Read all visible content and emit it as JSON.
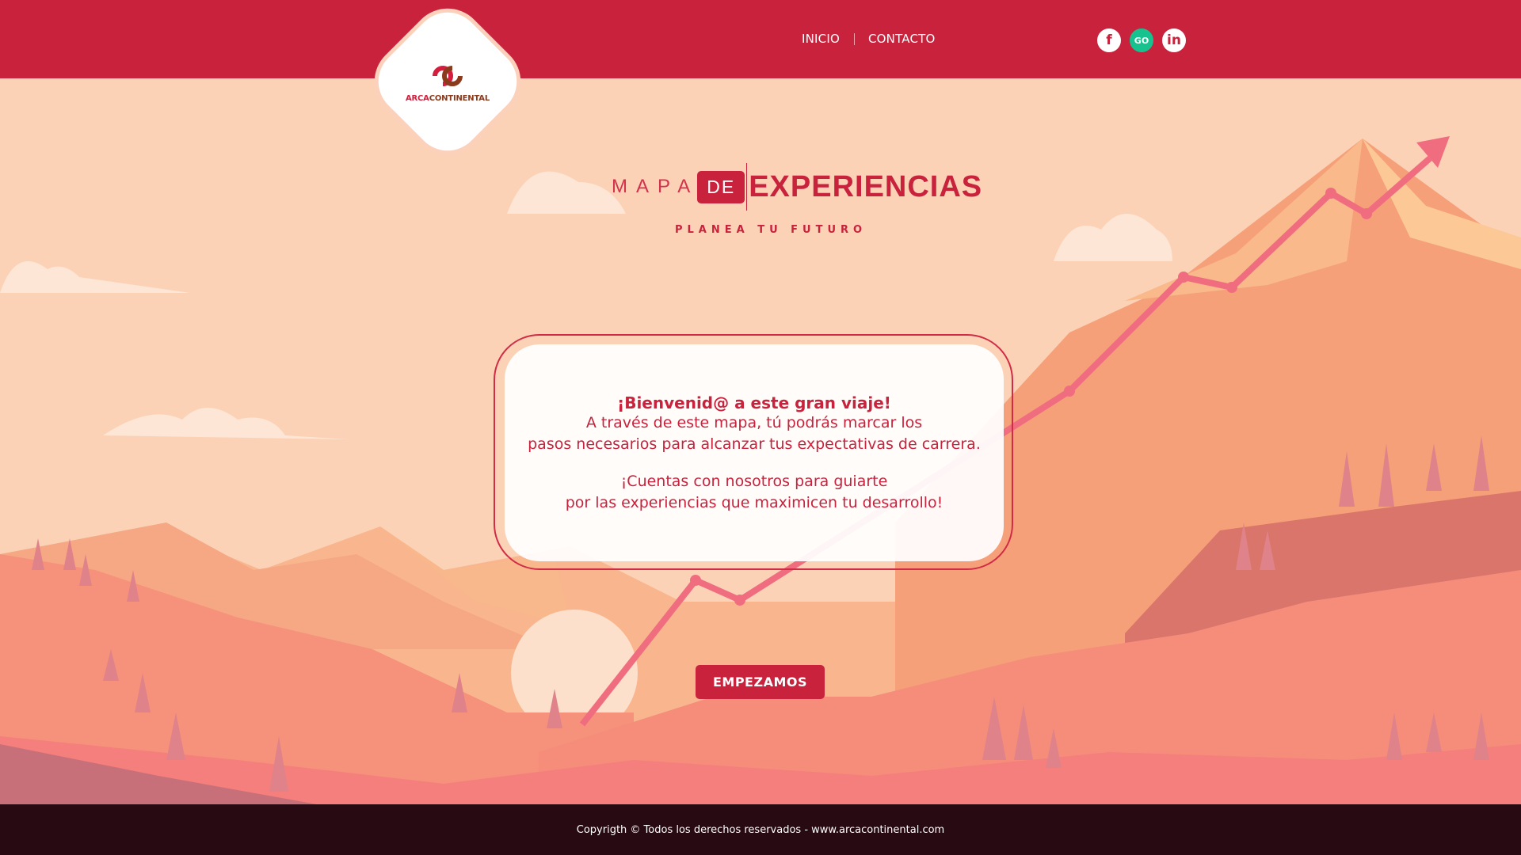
{
  "header": {
    "brand": {
      "arca": "ARCA",
      "continental": "CONTINENTAL"
    },
    "nav": [
      {
        "label": "INICIO"
      },
      {
        "label": "CONTACTO"
      }
    ],
    "social": [
      {
        "icon": "facebook-icon",
        "glyph": "f"
      },
      {
        "icon": "go-icon",
        "glyph": "GO"
      },
      {
        "icon": "linkedin-icon",
        "glyph": "in"
      }
    ]
  },
  "hero": {
    "title_mapa": "MAPA",
    "title_de": "DE",
    "title_experiencias": "EXPERIENCIAS",
    "subtitle": "PLANEA TU FUTURO"
  },
  "welcome": {
    "heading": "¡Bienvenid@ a este gran viaje!",
    "line1": "A través de este mapa, tú podrás marcar los",
    "line2": "pasos necesarios para alcanzar tus expectativas de carrera.",
    "line3": "¡Cuentas con nosotros para guiarte",
    "line4": "por las experiencias que maximicen tu desarrollo!"
  },
  "cta": {
    "label": "EMPEZAMOS"
  },
  "footer": {
    "text": "Copyrigth © Todos los derechos reservados - www.arcacontinental.com"
  },
  "colors": {
    "brand_red": "#c8223d",
    "footer_dark": "#270a12",
    "sky": "#fcd2b7",
    "go_green": "#18c28e"
  }
}
